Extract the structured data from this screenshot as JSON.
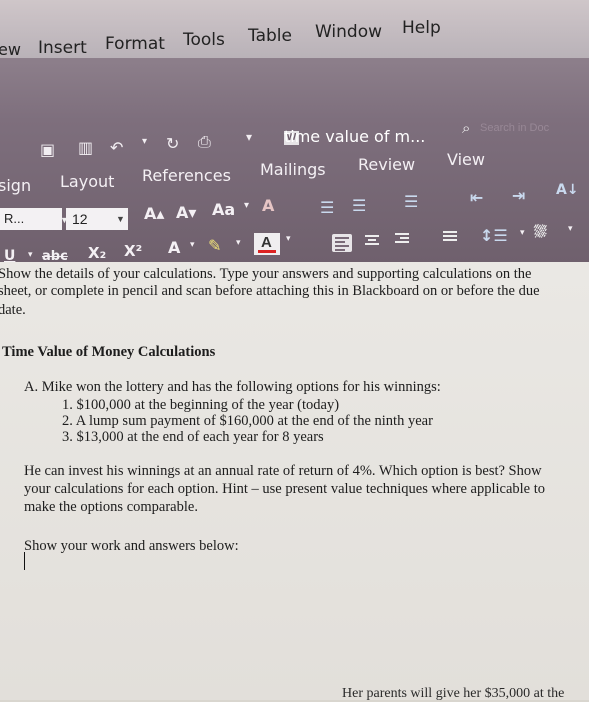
{
  "menubar": {
    "items": [
      "ew",
      "Insert",
      "Format",
      "Tools",
      "Table",
      "Window",
      "Help"
    ]
  },
  "titlebar": {
    "doc_title": "time value of m...",
    "search_placeholder": "Search in Doc"
  },
  "ribbon": {
    "tabs": [
      "sign",
      "Layout",
      "References",
      "Mailings",
      "Review",
      "View"
    ],
    "font_name": "R...",
    "font_size": "12",
    "strike_label": "abc",
    "subscript_label": "X₂",
    "superscript_label": "X²"
  },
  "document": {
    "lines": [
      "Show the details of your calculations. Type your answers and supporting calculations on the",
      "sheet, or complete in pencil and scan before attaching this in Blackboard on or before the due",
      "date."
    ],
    "heading": "Time Value of Money Calculations",
    "question_a": "A. Mike won the lottery and has the following options for his winnings:",
    "options": [
      "1.  $100,000 at the beginning of the year (today)",
      "2.  A lump sum payment of  $160,000 at the end of the ninth year",
      "3.  $13,000 at the end of each year for 8 years"
    ],
    "paragraph": [
      "He can invest his winnings at an annual rate of return of 4%.  Which option is best? Show",
      "your calculations for each option.  Hint – use present value techniques where applicable to",
      "make the options comparable."
    ],
    "instruction": "Show your work and answers below:",
    "bottom_text": "Her parents will give her $35,000 at the"
  }
}
